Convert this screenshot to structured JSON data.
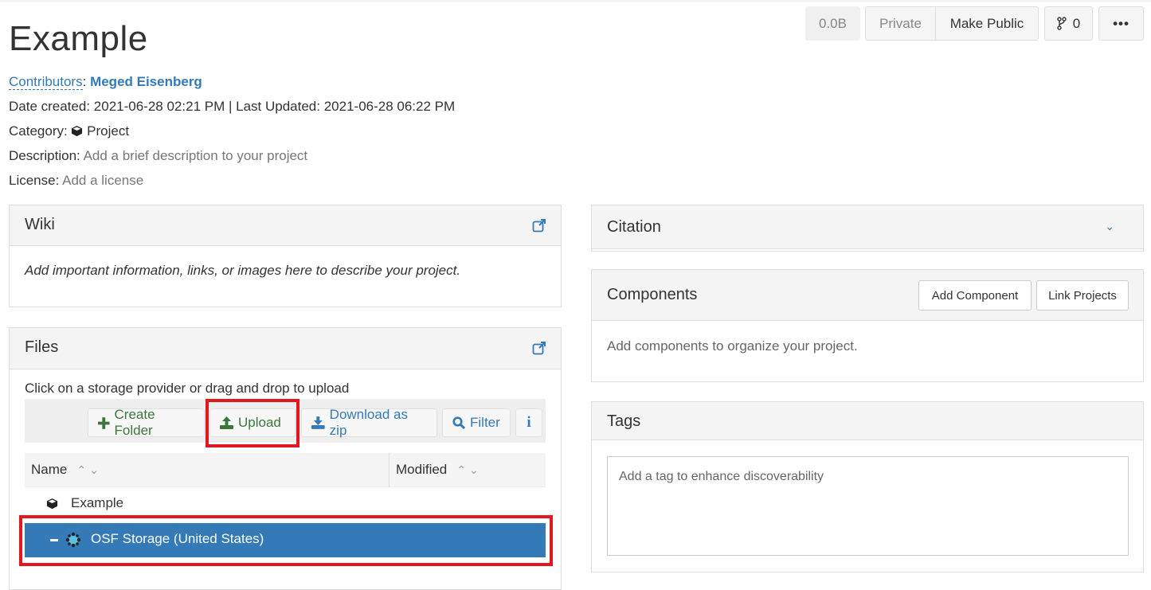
{
  "project": {
    "title": "Example",
    "contributors_label": "Contributors",
    "contributor_name": "Meged Eisenberg",
    "date_created_label": "Date created:",
    "date_created": "2021-06-28 02:21 PM",
    "last_updated_label": "Last Updated:",
    "last_updated": "2021-06-28 06:22 PM",
    "category_label": "Category:",
    "category": "Project",
    "description_label": "Description:",
    "description_placeholder": "Add a brief description to your project",
    "license_label": "License:",
    "license_placeholder": "Add a license"
  },
  "top_actions": {
    "size": "0.0B",
    "private_label": "Private",
    "make_public_label": "Make Public",
    "fork_count": "0",
    "more_label": "•••"
  },
  "wiki": {
    "title": "Wiki",
    "placeholder": "Add important information, links, or images here to describe your project."
  },
  "files": {
    "title": "Files",
    "hint": "Click on a storage provider or drag and drop to upload",
    "toolbar": {
      "create_folder": "Create Folder",
      "upload": "Upload",
      "download_zip": "Download as zip",
      "filter": "Filter",
      "info": "i"
    },
    "columns": {
      "name": "Name",
      "modified": "Modified"
    },
    "rows": [
      {
        "name": "Example",
        "icon": "cube-icon"
      },
      {
        "name": "OSF Storage (United States)",
        "icon": "osf-storage-icon",
        "selected": true
      }
    ]
  },
  "citation": {
    "title": "Citation"
  },
  "components": {
    "title": "Components",
    "add_component": "Add Component",
    "link_projects": "Link Projects",
    "empty_text": "Add components to organize your project."
  },
  "tags": {
    "title": "Tags",
    "placeholder": "Add a tag to enhance discoverability"
  },
  "colors": {
    "accent": "#337ab7",
    "success": "#3c763d",
    "highlight": "#e3171d",
    "selected_row": "#337ab7"
  }
}
